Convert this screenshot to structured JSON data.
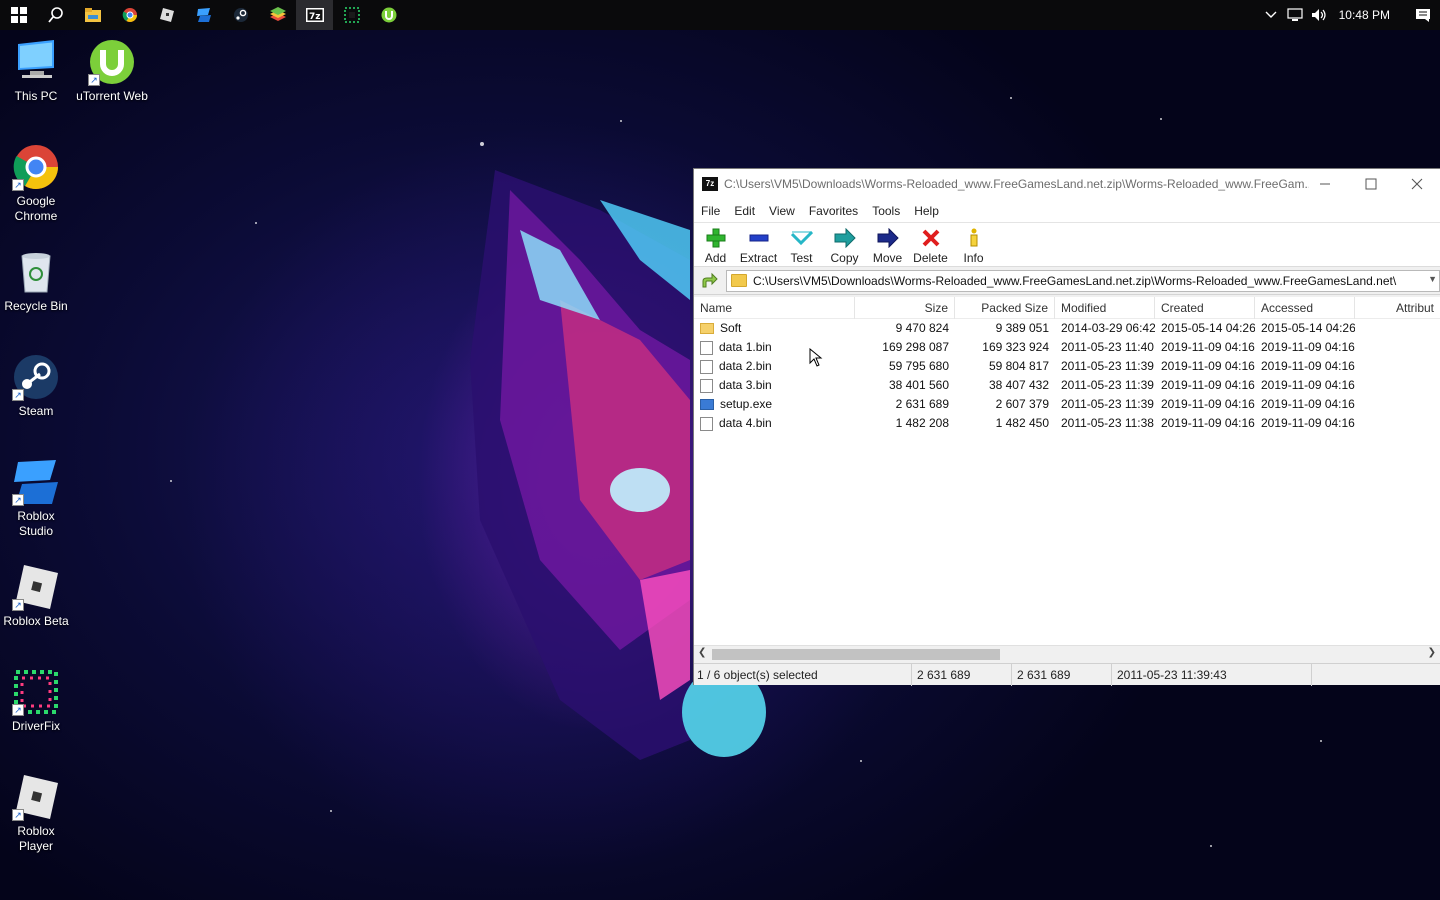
{
  "taskbar": {
    "icons": [
      "windows-start-icon",
      "search-icon",
      "file-explorer-icon",
      "chrome-icon",
      "roblox-icon",
      "roblox-studio-icon",
      "steam-icon",
      "bluestacks-icon",
      "7zip-icon",
      "driverfix-icon",
      "utorrent-icon"
    ],
    "active_index": 8,
    "clock": "10:48 PM"
  },
  "desktop": {
    "icons": [
      {
        "label": "This PC",
        "icon": "this-pc-icon"
      },
      {
        "label": "uTorrent Web",
        "icon": "utorrent-icon"
      },
      {
        "label": "Google Chrome",
        "icon": "chrome-icon"
      },
      {
        "label": "Recycle Bin",
        "icon": "recycle-bin-icon"
      },
      {
        "label": "Steam",
        "icon": "steam-icon"
      },
      {
        "label": "Roblox Studio",
        "icon": "roblox-studio-icon"
      },
      {
        "label": "Roblox Beta",
        "icon": "roblox-icon"
      },
      {
        "label": "DriverFix",
        "icon": "driverfix-icon"
      },
      {
        "label": "Roblox Player",
        "icon": "roblox-icon"
      }
    ]
  },
  "window": {
    "title": "C:\\Users\\VM5\\Downloads\\Worms-Reloaded_www.FreeGamesLand.net.zip\\Worms-Reloaded_www.FreeGam...",
    "app_icon_label": "7z",
    "menu": [
      "File",
      "Edit",
      "View",
      "Favorites",
      "Tools",
      "Help"
    ],
    "toolbar": {
      "add": "Add",
      "extract": "Extract",
      "test": "Test",
      "copy": "Copy",
      "move": "Move",
      "delete": "Delete",
      "info": "Info"
    },
    "address": "C:\\Users\\VM5\\Downloads\\Worms-Reloaded_www.FreeGamesLand.net.zip\\Worms-Reloaded_www.FreeGamesLand.net\\",
    "columns": {
      "name": "Name",
      "size": "Size",
      "packed": "Packed Size",
      "modified": "Modified",
      "created": "Created",
      "accessed": "Accessed",
      "attributes": "Attribut"
    },
    "files": [
      {
        "name": "Soft",
        "type": "folder",
        "size": "9 470 824",
        "packed": "9 389 051",
        "modified": "2014-03-29 06:42",
        "created": "2015-05-14 04:26",
        "accessed": "2015-05-14 04:26"
      },
      {
        "name": "data 1.bin",
        "type": "file",
        "size": "169 298 087",
        "packed": "169 323 924",
        "modified": "2011-05-23 11:40",
        "created": "2019-11-09 04:16",
        "accessed": "2019-11-09 04:16"
      },
      {
        "name": "data 2.bin",
        "type": "file",
        "size": "59 795 680",
        "packed": "59 804 817",
        "modified": "2011-05-23 11:39",
        "created": "2019-11-09 04:16",
        "accessed": "2019-11-09 04:16"
      },
      {
        "name": "data 3.bin",
        "type": "file",
        "size": "38 401 560",
        "packed": "38 407 432",
        "modified": "2011-05-23 11:39",
        "created": "2019-11-09 04:16",
        "accessed": "2019-11-09 04:16"
      },
      {
        "name": "setup.exe",
        "type": "exe",
        "size": "2 631 689",
        "packed": "2 607 379",
        "modified": "2011-05-23 11:39",
        "created": "2019-11-09 04:16",
        "accessed": "2019-11-09 04:16"
      },
      {
        "name": "data 4.bin",
        "type": "file",
        "size": "1 482 208",
        "packed": "1 482 450",
        "modified": "2011-05-23 11:38",
        "created": "2019-11-09 04:16",
        "accessed": "2019-11-09 04:16"
      }
    ],
    "status": {
      "selection": "1 / 6 object(s) selected",
      "size": "2 631 689",
      "packed": "2 631 689",
      "modified": "2011-05-23 11:39:43"
    }
  }
}
